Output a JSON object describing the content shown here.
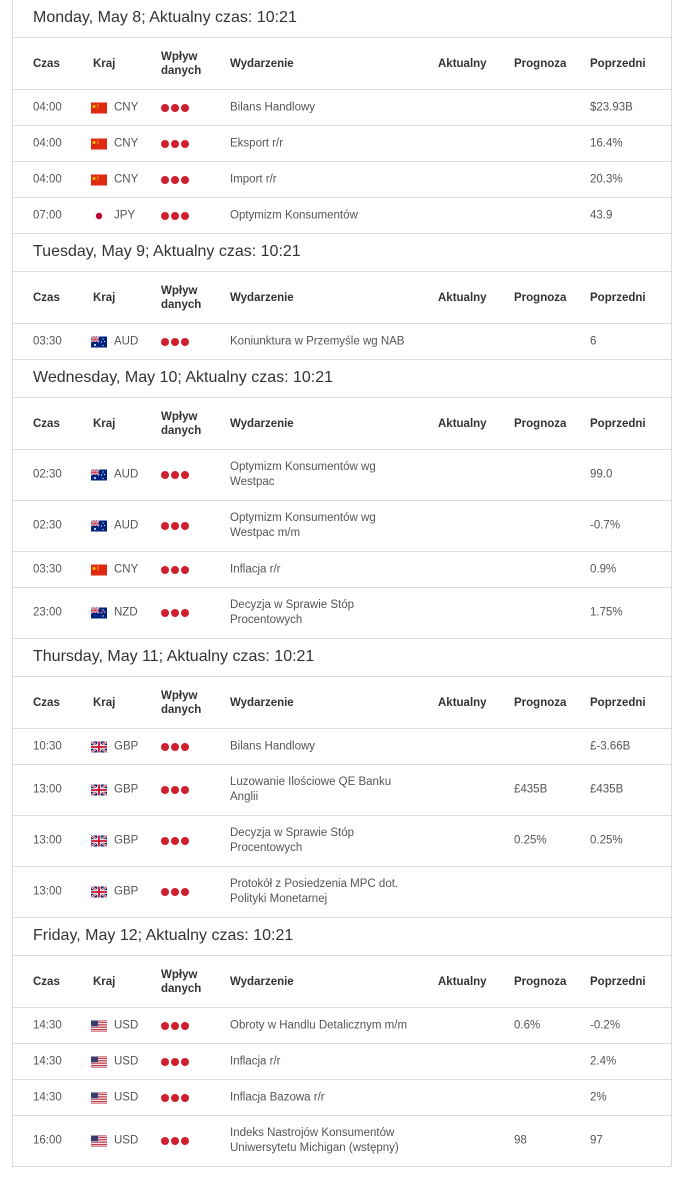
{
  "columns": {
    "time": "Czas",
    "country": "Kraj",
    "impact_line1": "Wpływ",
    "impact_line2": "danych",
    "event": "Wydarzenie",
    "actual": "Aktualny",
    "forecast": "Prognoza",
    "previous": "Poprzedni"
  },
  "impact_color": "#d0202f",
  "days": [
    {
      "title": "Monday, May 8; Aktualny czas: 10:21",
      "events": [
        {
          "time": "04:00",
          "flag": "cn-flag",
          "currency": "CNY",
          "impact": 3,
          "event": "Bilans Handlowy",
          "actual": "",
          "forecast": "",
          "previous": "$23.93B",
          "rows": 1
        },
        {
          "time": "04:00",
          "flag": "cn-flag",
          "currency": "CNY",
          "impact": 3,
          "event": "Eksport r/r",
          "actual": "",
          "forecast": "",
          "previous": "16.4%",
          "rows": 1
        },
        {
          "time": "04:00",
          "flag": "cn-flag",
          "currency": "CNY",
          "impact": 3,
          "event": "Import r/r",
          "actual": "",
          "forecast": "",
          "previous": "20.3%",
          "rows": 1
        },
        {
          "time": "07:00",
          "flag": "jp-flag",
          "currency": "JPY",
          "impact": 3,
          "event": "Optymizm Konsumentów",
          "actual": "",
          "forecast": "",
          "previous": "43.9",
          "rows": 1
        }
      ]
    },
    {
      "title": "Tuesday, May 9; Aktualny czas: 10:21",
      "events": [
        {
          "time": "03:30",
          "flag": "au-flag",
          "currency": "AUD",
          "impact": 3,
          "event": "Koniunktura w Przemyśle wg NAB",
          "actual": "",
          "forecast": "",
          "previous": "6",
          "rows": 1
        }
      ]
    },
    {
      "title": "Wednesday, May 10; Aktualny czas: 10:21",
      "events": [
        {
          "time": "02:30",
          "flag": "au-flag",
          "currency": "AUD",
          "impact": 3,
          "event": "Optymizm Konsumentów wg Westpac",
          "actual": "",
          "forecast": "",
          "previous": "99.0",
          "rows": 2
        },
        {
          "time": "02:30",
          "flag": "au-flag",
          "currency": "AUD",
          "impact": 3,
          "event": "Optymizm Konsumentów wg Westpac m/m",
          "actual": "",
          "forecast": "",
          "previous": "-0.7%",
          "rows": 2
        },
        {
          "time": "03:30",
          "flag": "cn-flag",
          "currency": "CNY",
          "impact": 3,
          "event": "Inflacja r/r",
          "actual": "",
          "forecast": "",
          "previous": "0.9%",
          "rows": 1
        },
        {
          "time": "23:00",
          "flag": "nz-flag",
          "currency": "NZD",
          "impact": 3,
          "event": "Decyzja w Sprawie Stóp Procentowych",
          "actual": "",
          "forecast": "",
          "previous": "1.75%",
          "rows": 2
        }
      ]
    },
    {
      "title": "Thursday, May 11; Aktualny czas: 10:21",
      "events": [
        {
          "time": "10:30",
          "flag": "gb-flag",
          "currency": "GBP",
          "impact": 3,
          "event": "Bilans Handlowy",
          "actual": "",
          "forecast": "",
          "previous": "£-3.66B",
          "rows": 1
        },
        {
          "time": "13:00",
          "flag": "gb-flag",
          "currency": "GBP",
          "impact": 3,
          "event": "Luzowanie Ilościowe QE Banku Anglii",
          "actual": "",
          "forecast": "£435B",
          "previous": "£435B",
          "rows": 2
        },
        {
          "time": "13:00",
          "flag": "gb-flag",
          "currency": "GBP",
          "impact": 3,
          "event": "Decyzja w Sprawie Stóp Procentowych",
          "actual": "",
          "forecast": "0.25%",
          "previous": "0.25%",
          "rows": 2
        },
        {
          "time": "13:00",
          "flag": "gb-flag",
          "currency": "GBP",
          "impact": 3,
          "event": "Protokół z Posiedzenia MPC dot. Polityki Monetarnej",
          "actual": "",
          "forecast": "",
          "previous": "",
          "rows": 2
        }
      ]
    },
    {
      "title": "Friday, May 12; Aktualny czas: 10:21",
      "events": [
        {
          "time": "14:30",
          "flag": "us-flag",
          "currency": "USD",
          "impact": 3,
          "event": "Obroty w Handlu Detalicznym m/m",
          "actual": "",
          "forecast": "0.6%",
          "previous": "-0.2%",
          "rows": 1
        },
        {
          "time": "14:30",
          "flag": "us-flag",
          "currency": "USD",
          "impact": 3,
          "event": "Inflacja r/r",
          "actual": "",
          "forecast": "",
          "previous": "2.4%",
          "rows": 1
        },
        {
          "time": "14:30",
          "flag": "us-flag",
          "currency": "USD",
          "impact": 3,
          "event": "Inflacja Bazowa r/r",
          "actual": "",
          "forecast": "",
          "previous": "2%",
          "rows": 1
        },
        {
          "time": "16:00",
          "flag": "us-flag",
          "currency": "USD",
          "impact": 3,
          "event": "Indeks Nastrojów Konsumentów Uniwersytetu Michigan (wstępny)",
          "actual": "",
          "forecast": "98",
          "previous": "97",
          "rows": 2
        }
      ]
    }
  ]
}
